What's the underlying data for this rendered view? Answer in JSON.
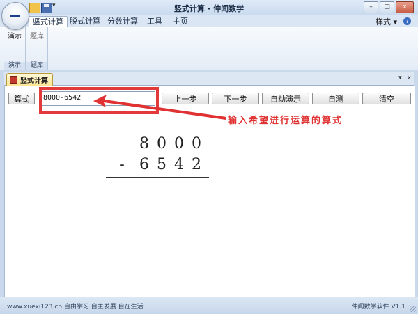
{
  "window": {
    "title": "竖式计算 - 仲闻数学",
    "controls": [
      "–",
      "□",
      "x"
    ]
  },
  "ribbon": {
    "tabs": [
      "竖式计算",
      "脱式计算",
      "分数计算",
      "工具",
      "主页"
    ],
    "style_label": "样式",
    "help": "?",
    "groups": [
      {
        "button": "演示",
        "label": "演示"
      },
      {
        "button": "题库",
        "label": "题库"
      }
    ]
  },
  "document": {
    "tab_label": "竖式计算",
    "toolbar": {
      "formula_label": "算式",
      "formula_value": "8000-6542",
      "prev_label": "上一步",
      "next_label": "下一步",
      "auto_demo_label": "自动演示",
      "self_test_label": "自测",
      "clear_label": "清空"
    },
    "annotation": "输入希望进行运算的算式",
    "calculation": {
      "top_digits": [
        "8",
        "0",
        "0",
        "0"
      ],
      "operator": "-",
      "bottom_digits": [
        "6",
        "5",
        "4",
        "2"
      ]
    }
  },
  "statusbar": {
    "left": "www.xuexi123.cn 自由学习 自主发展 自在生活",
    "right": "仲闻数学软件 V1.1"
  },
  "colors": {
    "annotation": "#e03232",
    "tab_highlight": "#ffe593",
    "ribbon_bg": "#dbe6f4"
  }
}
